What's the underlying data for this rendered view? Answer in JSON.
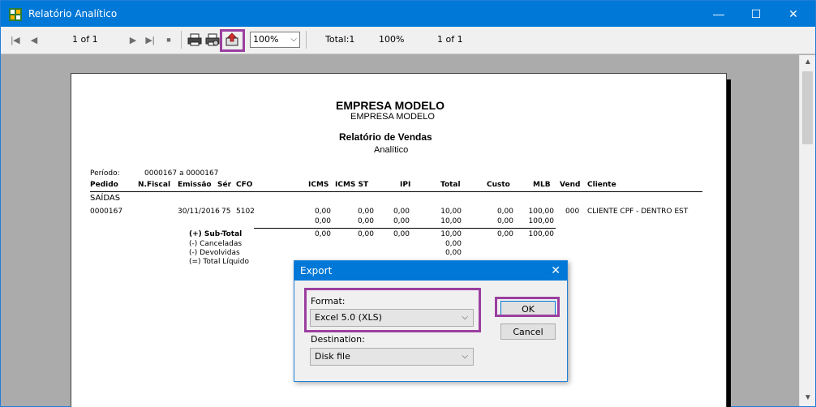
{
  "window": {
    "title": "Relatório Analítico",
    "minimize_glyph": "—",
    "maximize_glyph": "☐",
    "close_glyph": "✕"
  },
  "toolbar": {
    "first_glyph": "|◀",
    "prev_glyph": "◀",
    "page_indicator": "1 of 1",
    "next_glyph": "▶",
    "last_glyph": "▶|",
    "stop_glyph": "■",
    "zoom_value": "100%",
    "zoom_chevron": "⌵",
    "total_text": "Total:1",
    "percent_text": "100%",
    "pages_text": "1 of 1",
    "icons": [
      "first-page-icon",
      "previous-page-icon",
      "next-page-icon",
      "last-page-icon",
      "stop-icon",
      "print-icon",
      "print-setup-icon",
      "export-icon"
    ]
  },
  "report": {
    "company": "EMPRESA MODELO",
    "company_sub": "EMPRESA MODELO",
    "title": "Relatório de Vendas",
    "subtitle": "Analítico",
    "period_label": "Período:",
    "period_value": "0000167 a 0000167",
    "columns": [
      "Pedido",
      "N.Fiscal",
      "Emissão",
      "Sér",
      "CFO",
      "ICMS",
      "ICMS ST",
      "IPI",
      "Total",
      "Custo",
      "MLB",
      "Vend",
      "Cliente"
    ],
    "section": "SAÍDAS",
    "row": {
      "pedido": "0000167",
      "emissao": "30/11/2016",
      "ser": "75",
      "cfo": "5102",
      "icms": "0,00",
      "icms_st": "0,00",
      "ipi": "0,00",
      "total": "10,00",
      "custo": "0,00",
      "mlb": "100,00",
      "vend": "000",
      "cliente": "CLIENTE CPF - DENTRO EST"
    },
    "row2": {
      "icms": "0,00",
      "icms_st": "0,00",
      "ipi": "0,00",
      "total": "10,00",
      "custo": "0,00",
      "mlb": "100,00"
    },
    "summary": {
      "subtotal_label": "(+) Sub-Total",
      "canceladas_label": "(-) Canceladas",
      "devolvidas_label": "(-) Devolvidas",
      "liquido_label": "(=) Total Líquido",
      "subtotal_icms": "0,00",
      "subtotal_icms_st": "0,00",
      "subtotal_ipi": "0,00",
      "subtotal_total": "10,00",
      "subtotal_custo": "0,00",
      "subtotal_mlb": "100,00",
      "canceladas_total": "0,00",
      "devolvidas_total": "0,00"
    }
  },
  "export_dialog": {
    "title": "Export",
    "close_glyph": "✕",
    "format_label": "Format:",
    "format_value": "Excel 5.0 (XLS)",
    "destination_label": "Destination:",
    "destination_value": "Disk file",
    "ok_label": "OK",
    "cancel_label": "Cancel",
    "chevron": "⌵"
  },
  "colors": {
    "titlebar": "#0078d7",
    "highlight": "#9b3fa0",
    "preview_bg": "#ababab"
  }
}
